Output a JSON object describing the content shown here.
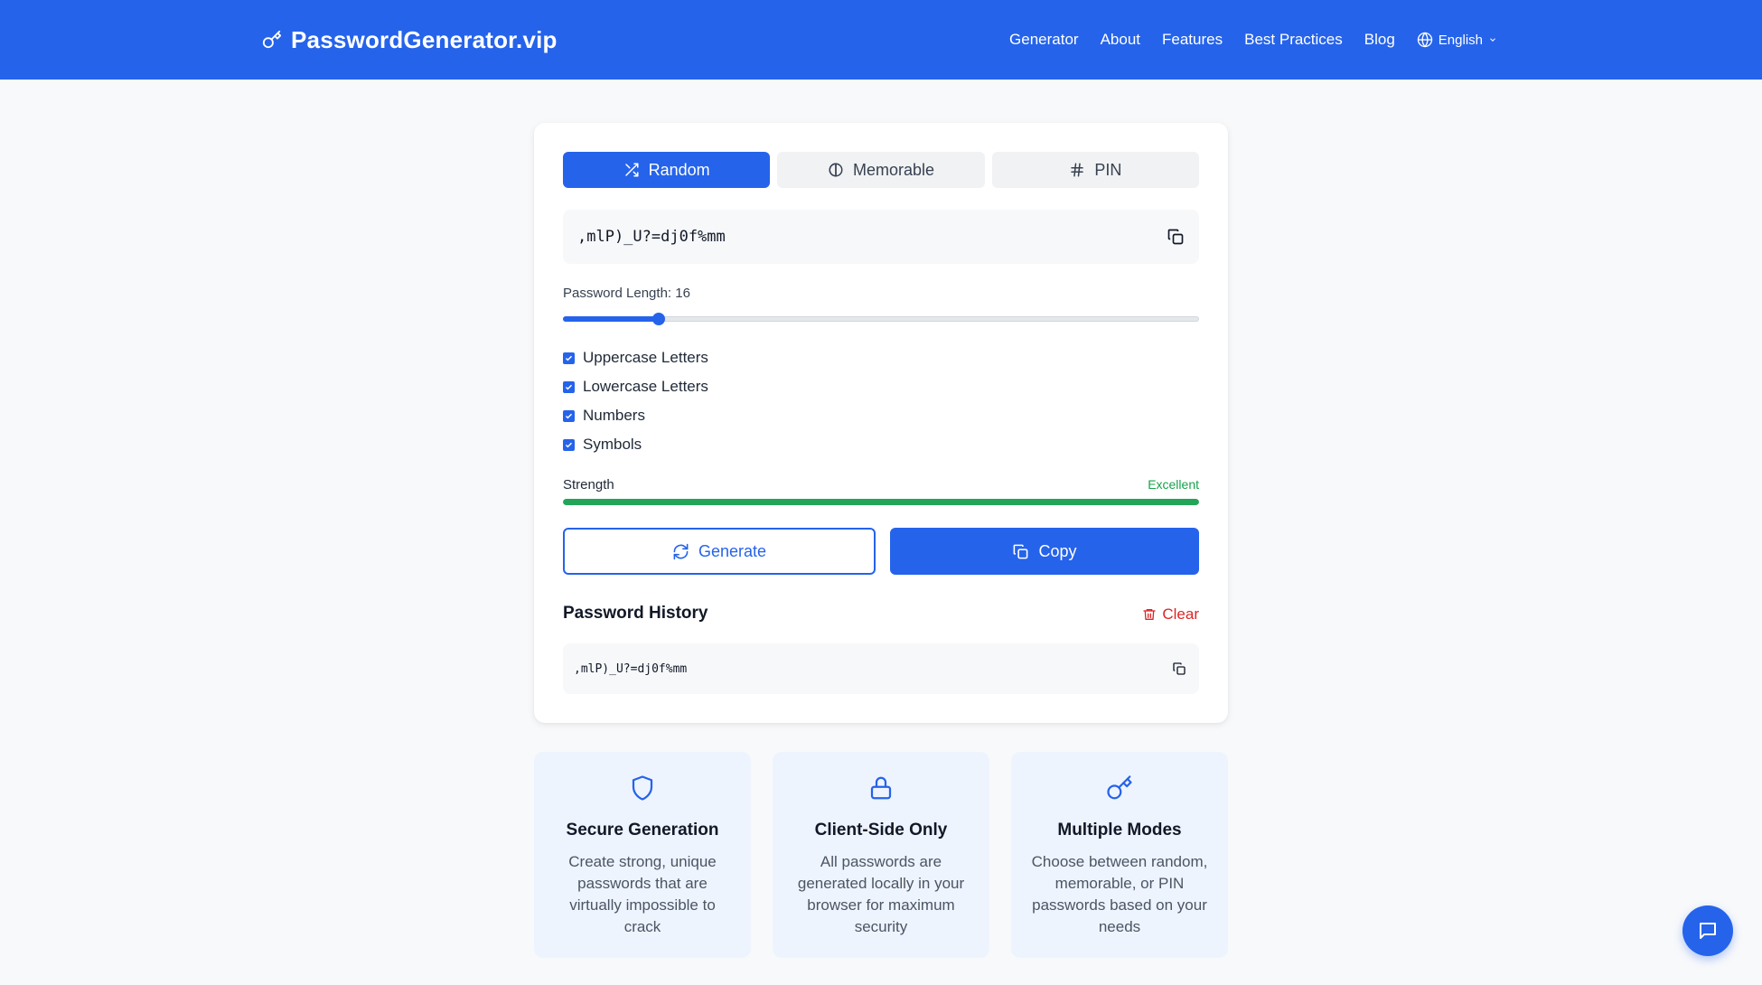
{
  "header": {
    "brand": "PasswordGenerator.vip",
    "nav": [
      "Generator",
      "About",
      "Features",
      "Best Practices",
      "Blog"
    ],
    "language": "English"
  },
  "generator": {
    "tabs": [
      {
        "label": "Random",
        "icon": "shuffle-icon",
        "active": true
      },
      {
        "label": "Memorable",
        "icon": "contrast-icon",
        "active": false
      },
      {
        "label": "PIN",
        "icon": "hash-icon",
        "active": false
      }
    ],
    "password": ",mlP)_U?=dj0f%mm",
    "length_label": "Password Length: 16",
    "length_value": 16,
    "length_fraction": 0.15,
    "options": [
      {
        "label": "Uppercase Letters",
        "checked": true
      },
      {
        "label": "Lowercase Letters",
        "checked": true
      },
      {
        "label": "Numbers",
        "checked": true
      },
      {
        "label": "Symbols",
        "checked": true
      }
    ],
    "strength_label": "Strength",
    "strength_value": "Excellent",
    "strength_fraction": 1.0,
    "generate_label": "Generate",
    "copy_label": "Copy"
  },
  "history": {
    "title": "Password History",
    "clear_label": "Clear",
    "items": [
      ",mlP)_U?=dj0f%mm"
    ]
  },
  "features": [
    {
      "icon": "shield-icon",
      "title": "Secure Generation",
      "desc": "Create strong, unique passwords that are virtually impossible to crack"
    },
    {
      "icon": "lock-icon",
      "title": "Client-Side Only",
      "desc": "All passwords are generated locally in your browser for maximum security"
    },
    {
      "icon": "key-icon",
      "title": "Multiple Modes",
      "desc": "Choose between random, memorable, or PIN passwords based on your needs"
    }
  ],
  "colors": {
    "primary": "#2563eb",
    "success": "#22a559",
    "danger": "#dc2626"
  }
}
